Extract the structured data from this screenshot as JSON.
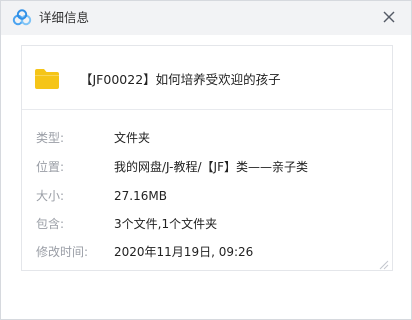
{
  "window": {
    "title": "详细信息",
    "app_icon": "cloud-icon",
    "close_icon": "close-icon"
  },
  "file": {
    "icon": "folder-icon",
    "name": "【JF00022】如何培养受欢迎的孩子"
  },
  "details": [
    {
      "label": "类型:",
      "value": "文件夹"
    },
    {
      "label": "位置:",
      "value": "我的网盘/J-教程/【JF】类——亲子类"
    },
    {
      "label": "大小:",
      "value": "27.16MB"
    },
    {
      "label": "包含:",
      "value": "3个文件,1个文件夹"
    },
    {
      "label": "修改时间:",
      "value": "2020年11月19日, 09:26"
    }
  ],
  "colors": {
    "folder": "#f5c518",
    "app_icon": "#4aa3f0",
    "label": "#9a9ea6",
    "value": "#222222"
  }
}
